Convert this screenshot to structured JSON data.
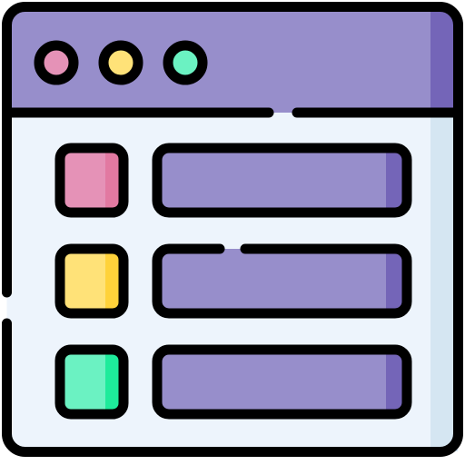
{
  "icon": {
    "name": "browser-list-window-icon",
    "window": {
      "frame_color": "#000000",
      "titlebar_color": "#978ECB",
      "titlebar_shade_color": "#7465B8",
      "body_color": "#EDF4FC",
      "body_shade_color": "#D5E6F2",
      "controls": [
        {
          "name": "control-dot-close",
          "color": "#E592B7"
        },
        {
          "name": "control-dot-minimize",
          "color": "#FFE278"
        },
        {
          "name": "control-dot-maximize",
          "color": "#6BF2C2"
        }
      ]
    },
    "list_rows": [
      {
        "name": "list-row-1",
        "swatch_color": "#E592B7",
        "swatch_shade": "#E279A1",
        "bar_color": "#978ECB",
        "bar_shade": "#7465B8"
      },
      {
        "name": "list-row-2",
        "swatch_color": "#FFE278",
        "swatch_shade": "#FFD23A",
        "bar_color": "#978ECB",
        "bar_shade": "#7465B8"
      },
      {
        "name": "list-row-3",
        "swatch_color": "#6BF2C2",
        "swatch_shade": "#1EEB9B",
        "bar_color": "#978ECB",
        "bar_shade": "#7465B8"
      }
    ]
  }
}
